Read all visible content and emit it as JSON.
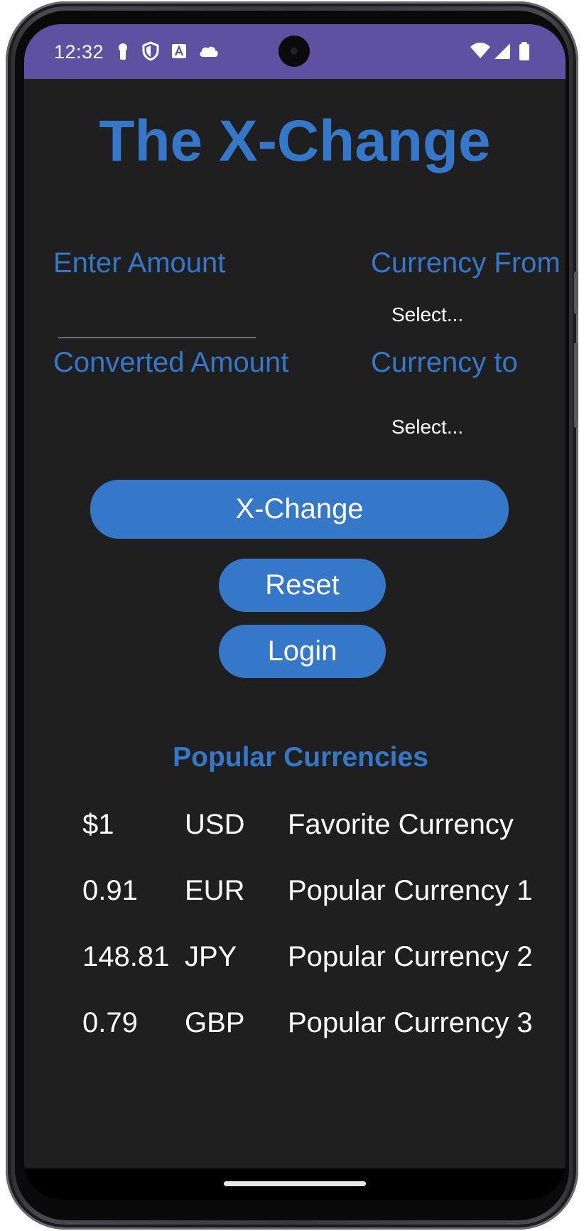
{
  "status_bar": {
    "time": "12:32",
    "left_icons": [
      "key-icon",
      "shield-icon",
      "a-icon",
      "cloud-icon"
    ],
    "right_icons": [
      "wifi-icon",
      "signal-icon",
      "battery-icon"
    ],
    "background": "#5f51a1"
  },
  "app": {
    "title": "The X-Change",
    "accent_color": "#3577c8",
    "background": "#1f1f1f"
  },
  "form": {
    "enter_amount_label": "Enter Amount",
    "amount_value": "",
    "converted_amount_label": "Converted Amount",
    "converted_amount_value": "",
    "currency_from_label": "Currency From",
    "currency_from_selected": "Select...",
    "currency_to_label": "Currency to",
    "currency_to_selected": "Select..."
  },
  "buttons": {
    "xchange": "X-Change",
    "reset": "Reset",
    "login": "Login"
  },
  "popular": {
    "title": "Popular Currencies",
    "rows": [
      {
        "rate": "$1",
        "code": "USD",
        "label": "Favorite Currency"
      },
      {
        "rate": "0.91",
        "code": "EUR",
        "label": "Popular Currency 1"
      },
      {
        "rate": "148.81",
        "code": "JPY",
        "label": "Popular Currency 2"
      },
      {
        "rate": "0.79",
        "code": "GBP",
        "label": "Popular Currency 3"
      }
    ]
  }
}
